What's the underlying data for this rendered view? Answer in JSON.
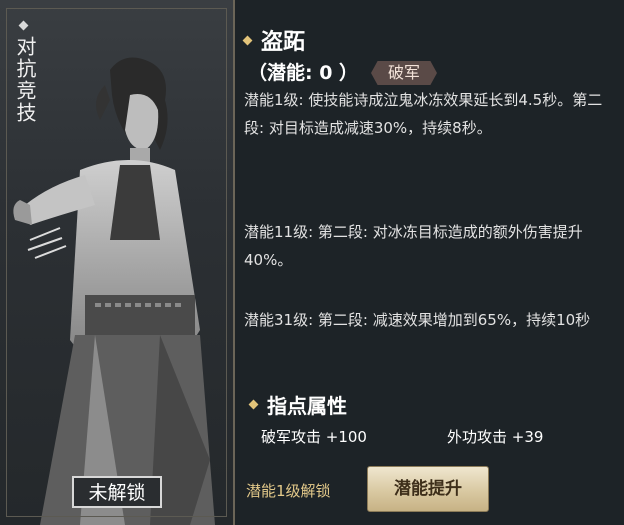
{
  "card": {
    "tag": "对抗竞技",
    "locked_label": "未解锁"
  },
  "skill": {
    "name": "盗跖",
    "potential": "（潜能: 0 ）",
    "badge": "破军"
  },
  "descriptions": [
    "潜能1级: 使技能诗成泣鬼冰冻效果延长到4.5秒。第二段: 对目标造成减速30%，持续8秒。",
    "潜能11级: 第二段: 对冰冻目标造成的额外伤害提升40%。",
    "潜能31级: 第二段: 减速效果增加到65%，持续10秒"
  ],
  "attributes": {
    "title": "指点属性",
    "items": [
      {
        "label": "破军攻击 +100"
      },
      {
        "label": "外功攻击 +39"
      }
    ]
  },
  "footer": {
    "unlock_text": "潜能1级解锁",
    "button_label": "潜能提升"
  },
  "colors": {
    "accent_gold": "#e3c47a",
    "button_bg": "#d9c9a2",
    "badge_bg": "#5a4a47"
  }
}
